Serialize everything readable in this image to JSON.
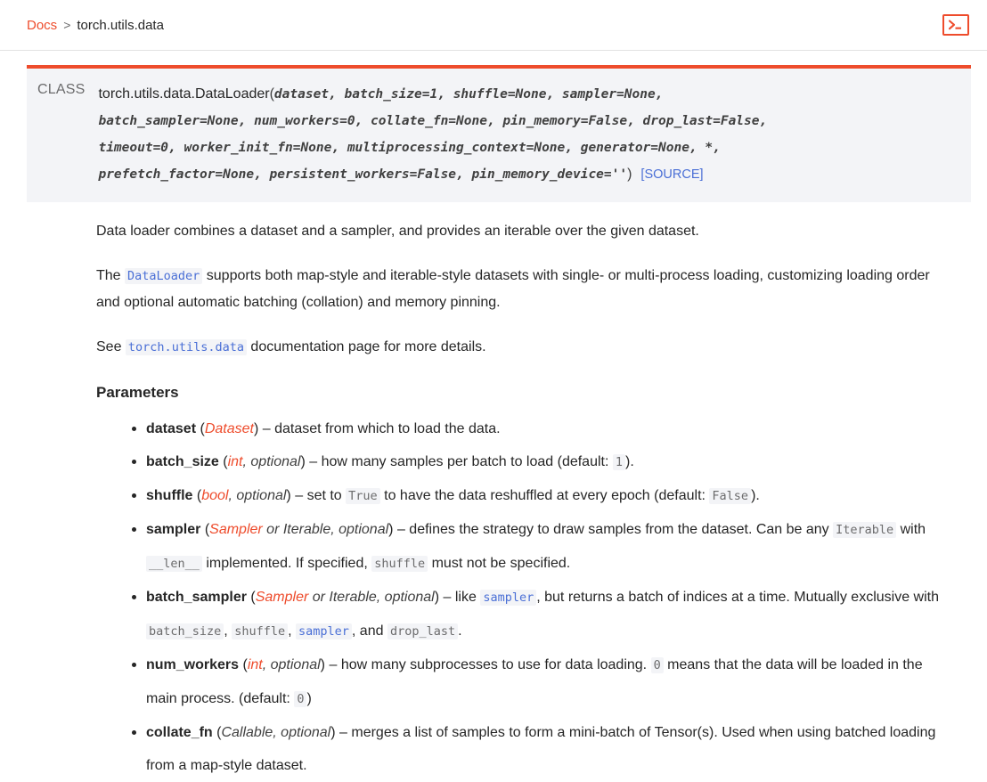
{
  "header": {
    "breadcrumb": {
      "root_label": "Docs",
      "separator": ">",
      "current_label": "torch.utils.data"
    },
    "terminal_button": {
      "icon": "terminal-icon",
      "label": ">_"
    }
  },
  "signature": {
    "kind_label": "CLASS",
    "qualified_name": "torch.utils.data.DataLoader",
    "open_paren": "(",
    "close_paren": ")",
    "lines": [
      "dataset, batch_size=1, shuffle=None, sampler=None,",
      "batch_sampler=None, num_workers=0, collate_fn=None, pin_memory=False, drop_last=False,",
      "timeout=0, worker_init_fn=None, multiprocessing_context=None, generator=None, *,",
      "prefetch_factor=None, persistent_workers=False, pin_memory_device=''"
    ],
    "source_link": "[SOURCE]"
  },
  "paragraphs": {
    "p1": "Data loader combines a dataset and a sampler, and provides an iterable over the given dataset.",
    "p2_a": "The",
    "p2_code": "DataLoader",
    "p2_b": "supports both map-style and iterable-style datasets with single- or multi-process loading, customizing loading order and optional automatic batching (collation) and memory pinning.",
    "p3_a": "See",
    "p3_code": "torch.utils.data",
    "p3_b": "documentation page for more details."
  },
  "parameters_heading": "Parameters",
  "parameters": [
    {
      "name": "dataset",
      "type_link": "Dataset",
      "type_plain": "",
      "desc_1": "dataset from which to load the data.",
      "code_1": "",
      "desc_2": "",
      "code_2": "",
      "desc_3": "",
      "code_3": "",
      "desc_4": "",
      "code_4": "",
      "desc_5": ""
    },
    {
      "name": "batch_size",
      "type_link": "int",
      "type_plain": ", optional",
      "desc_1": "how many samples per batch to load (default:",
      "code_1": "1",
      "desc_2": ").",
      "code_2": "",
      "desc_3": "",
      "code_3": "",
      "desc_4": "",
      "code_4": "",
      "desc_5": ""
    },
    {
      "name": "shuffle",
      "type_link": "bool",
      "type_plain": ", optional",
      "desc_1": "set to",
      "code_1": "True",
      "desc_2": "to have the data reshuffled at every epoch (default:",
      "code_2": "False",
      "desc_3": ").",
      "code_3": "",
      "desc_4": "",
      "code_4": "",
      "desc_5": ""
    },
    {
      "name": "sampler",
      "type_link": "Sampler",
      "type_plain": " or Iterable, optional",
      "desc_1": "defines the strategy to draw samples from the dataset. Can be any",
      "code_1": "Iterable",
      "desc_2": "with",
      "code_2": "__len__",
      "desc_3": "implemented. If specified,",
      "code_3": "shuffle",
      "desc_4": "must not be specified.",
      "code_4": "",
      "desc_5": ""
    },
    {
      "name": "batch_sampler",
      "type_link": "Sampler",
      "type_plain": " or Iterable, optional",
      "desc_1": "like",
      "code_1": "sampler",
      "desc_2": ", but returns a batch of indices at a time. Mutually exclusive with",
      "code_2": "batch_size",
      "desc_3": ",",
      "code_3": "shuffle",
      "desc_4": ",",
      "code_4": "sampler",
      "desc_5": ", and",
      "code_5": "drop_last",
      "desc_6": "."
    },
    {
      "name": "num_workers",
      "type_link": "int",
      "type_plain": ", optional",
      "desc_1": "how many subprocesses to use for data loading.",
      "code_1": "0",
      "desc_2": "means that the data will be loaded in the main process. (default:",
      "code_2": "0",
      "desc_3": ")",
      "code_3": "",
      "desc_4": "",
      "code_4": "",
      "desc_5": ""
    },
    {
      "name": "collate_fn",
      "type_link": "",
      "type_plain": "Callable, optional",
      "desc_1": "merges a list of samples to form a mini-batch of Tensor(s). Used when using batched loading from a map-style dataset.",
      "code_1": "",
      "desc_2": "",
      "code_2": "",
      "desc_3": "",
      "code_3": "",
      "desc_4": "",
      "code_4": "",
      "desc_5": ""
    }
  ],
  "colors": {
    "accent": "#ee4c2c",
    "link_blue": "#4a6fd6",
    "code_gray": "#6c6c6d",
    "sig_bg": "#f3f4f7",
    "text": "#262626"
  }
}
